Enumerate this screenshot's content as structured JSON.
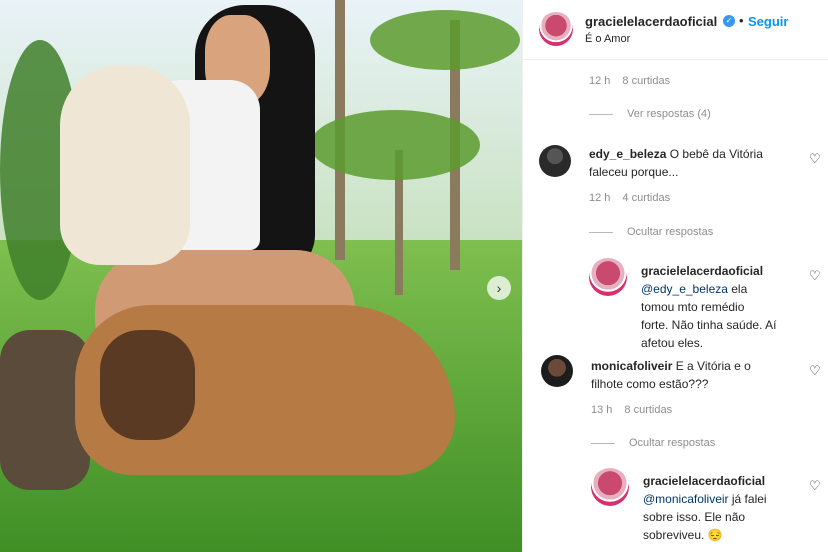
{
  "header": {
    "username": "gracielelacerdaoficial",
    "verified_symbol": "✓",
    "dot": "•",
    "follow_label": "Seguir",
    "subtitle": "É o Amor"
  },
  "photo": {
    "next_glyph": "›"
  },
  "comments": [
    {
      "meta_time": "12 h",
      "meta_likes": "8 curtidas"
    },
    {
      "replies_label": "Ver respostas (4)"
    },
    {
      "user": "edy_e_beleza",
      "text_line1": " O bebê da Vitória",
      "text_line2": "faleceu porque...",
      "meta_time": "12 h",
      "meta_likes": "4 curtidas",
      "replies_label": "Ocultar respostas"
    },
    {
      "user": "gracielelacerdaoficial",
      "mention": "@edy_e_beleza",
      "text_line1": " ela",
      "text_line2": "tomou mto remédio",
      "text_line3": "forte. Não tinha saúde. Aí",
      "text_line4": "afetou eles."
    },
    {
      "user": "monicafoliveir",
      "text_line1": " E a Vitória e o",
      "text_line2": "filhote como estão???",
      "meta_time": "13 h",
      "meta_likes": "8 curtidas",
      "replies_label": "Ocultar respostas"
    },
    {
      "user": "gracielelacerdaoficial",
      "mention": "@monicafoliveir",
      "text_line1": " já falei",
      "text_line2": "sobre isso. Ele não",
      "text_line3": "sobreviveu. 😔"
    }
  ],
  "icons": {
    "heart": "♡"
  }
}
